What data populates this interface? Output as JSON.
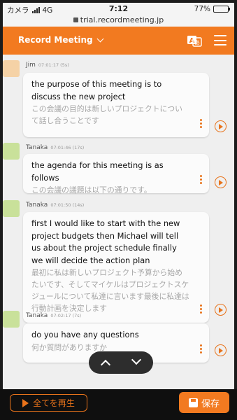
{
  "status_bar": {
    "carrier": "カメラ",
    "network": "4G",
    "time": "7:12",
    "url": "trial.recordmeeting.jp",
    "battery": "77%",
    "battery_level": 0.77
  },
  "header": {
    "title": "Record Meeting",
    "accent_color": "#f27a20"
  },
  "messages": [
    {
      "speaker": "Jim",
      "timestamp": "07:01:17 (5s)",
      "text_en": "the purpose of this meeting is to discuss the new project",
      "text_ja": "この会議の目的は新しいプロジェクトについて話し合うことです"
    },
    {
      "speaker": "Tanaka",
      "timestamp": "07:01:46 (17s)",
      "text_en": "the agenda for this meeting is as follows",
      "text_ja": "この会議の議題は以下の通りです。"
    },
    {
      "speaker": "Tanaka",
      "timestamp": "07:01:50 (14s)",
      "text_en": "first I would like to start with the new project budgets then Michael will tell us about the project schedule finally we will decide the action plan",
      "text_ja": "最初に私は新しいプロジェクト予算から始めたいです、そしてマイケルはプロジェクトスケジュールについて私達に言います最後に私達は行動計画を決定します"
    },
    {
      "speaker": "Tanaka",
      "timestamp": "07:02:17 (7s)",
      "text_en": "do you have any questions",
      "text_ja": "何か質問がありますか"
    }
  ],
  "footer": {
    "play_all_label": "全てを再生",
    "save_label": "保存"
  }
}
